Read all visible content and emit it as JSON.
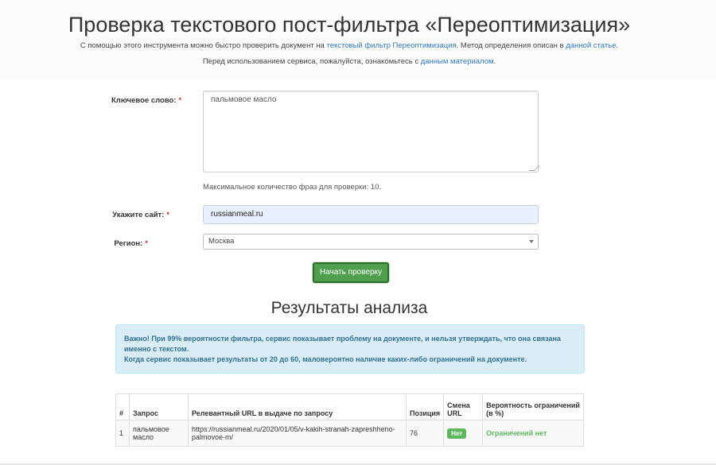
{
  "header": {
    "title": "Проверка текстового пост-фильтра «Переоптимизация»",
    "intro_1_prefix": "С помощью этого инструмента можно быстро проверить документ на ",
    "intro_1_link_1": "текстовый фильтр Переоптимизация",
    "intro_1_middle": ". Метод определения описан в ",
    "intro_1_link_2": "данной статье",
    "intro_1_suffix": ".",
    "intro_2_prefix": "Перед использованием сервиса, пожалуйста, ознакомьтесь с ",
    "intro_2_link": "данным материалом",
    "intro_2_suffix": "."
  },
  "form": {
    "keyword_label": "Ключевое слово:",
    "keyword_value": "пальмовое масло",
    "keyword_help": "Максимальное количество фраз для проверки: 10.",
    "site_label": "Укажите сайт:",
    "site_value": "russianmeal.ru",
    "region_label": "Регион:",
    "region_value": "Москва",
    "required_mark": "*",
    "submit_label": "Начать проверку"
  },
  "results": {
    "title": "Результаты анализа",
    "alert_line_1": "Важно! При 99% вероятности фильтра, сервис показывает проблему на документе, и нельзя утверждать, что она связана именно с текстом.",
    "alert_line_2": "Когда сервис показывает результаты от 20 до 60, маловероятно наличие каких-либо ограничений на документе.",
    "table": {
      "headers": [
        "#",
        "Запрос",
        "Релевантный URL в выдаче по запросу",
        "Позиция",
        "Смена URL",
        "Вероятность ограничений (в %)"
      ],
      "rows": [
        {
          "num": "1",
          "query": "пальмовое масло",
          "url": "https://russianmeal.ru/2020/01/05/v-kakih-stranah-zapreshheno-palmovoe-m/",
          "position": "76",
          "url_change": "Нет",
          "probability": "Ограничений нет"
        }
      ]
    }
  },
  "colors": {
    "link": "#337ab7",
    "success": "#5cb85c",
    "alert_bg": "#d9edf7",
    "alert_text": "#31708f"
  }
}
